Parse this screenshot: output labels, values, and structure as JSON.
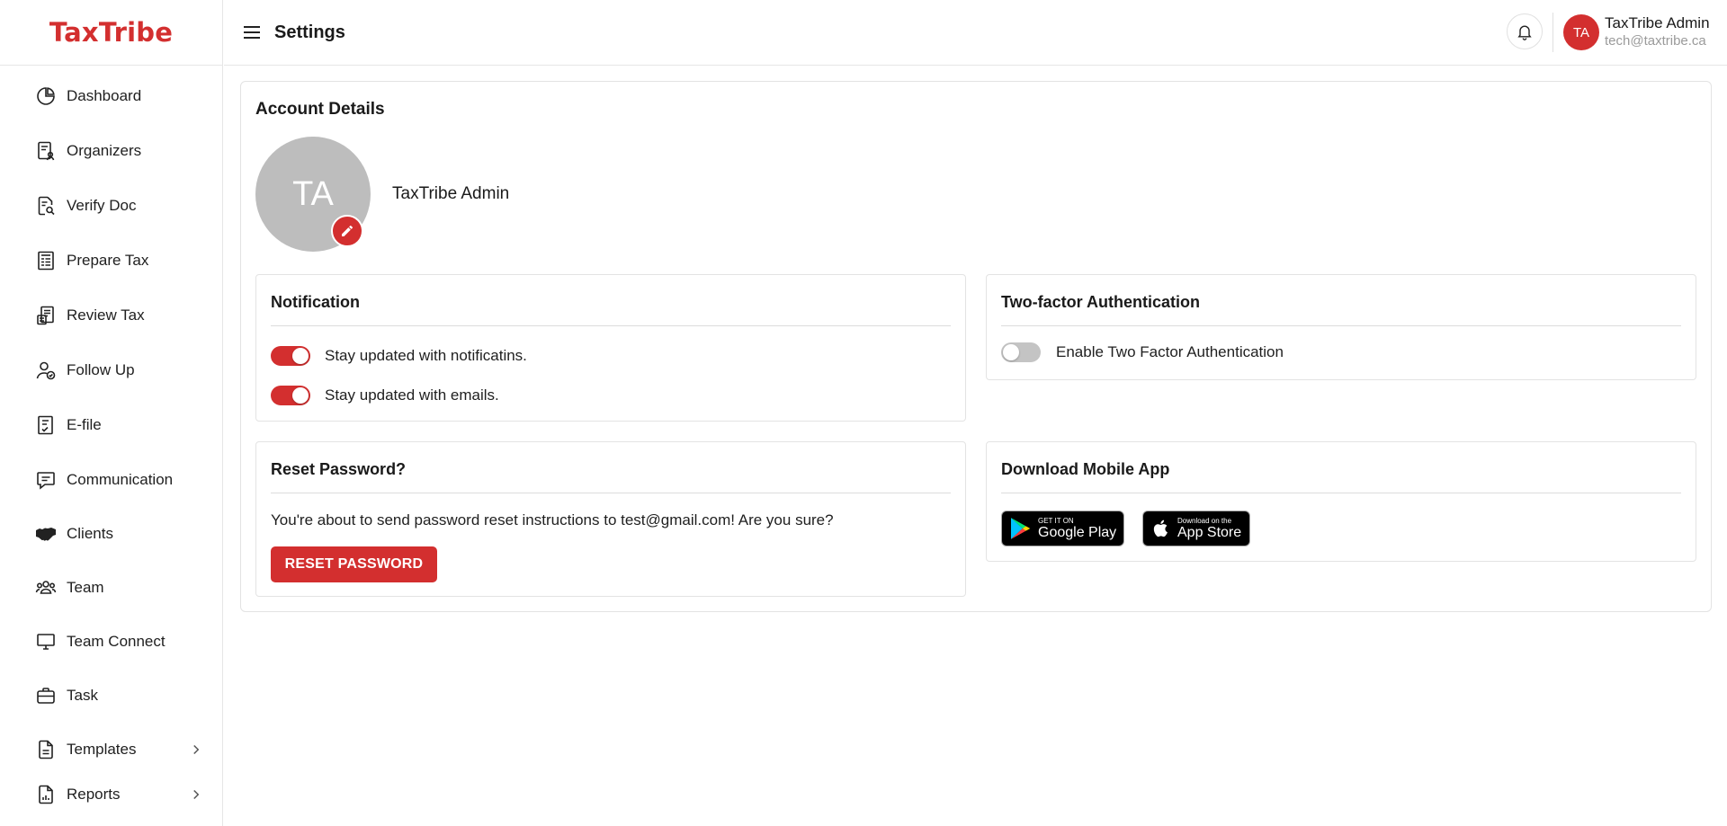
{
  "brand": {
    "name": "TaxTribe"
  },
  "header": {
    "title": "Settings",
    "avatar_initials": "TA",
    "user_name": "TaxTribe Admin",
    "user_email": "tech@taxtribe.ca"
  },
  "sidebar": {
    "items": [
      {
        "label": "Dashboard",
        "icon": "pie-chart-icon"
      },
      {
        "label": "Organizers",
        "icon": "document-person-icon"
      },
      {
        "label": "Verify Doc",
        "icon": "document-search-icon"
      },
      {
        "label": "Prepare Tax",
        "icon": "tax-form-icon"
      },
      {
        "label": "Review Tax",
        "icon": "tax-review-icon"
      },
      {
        "label": "Follow Up",
        "icon": "user-check-icon"
      },
      {
        "label": "E-file",
        "icon": "efile-icon"
      },
      {
        "label": "Communication",
        "icon": "message-icon"
      },
      {
        "label": "Clients",
        "icon": "handshake-icon"
      },
      {
        "label": "Team",
        "icon": "team-icon"
      },
      {
        "label": "Team Connect",
        "icon": "monitor-icon"
      },
      {
        "label": "Task",
        "icon": "briefcase-icon"
      },
      {
        "label": "Templates",
        "icon": "template-icon",
        "has_submenu": true
      },
      {
        "label": "Reports",
        "icon": "report-icon",
        "has_submenu": true
      }
    ]
  },
  "account": {
    "title": "Account Details",
    "avatar_initials": "TA",
    "name": "TaxTribe Admin"
  },
  "notification": {
    "title": "Notification",
    "toggles": [
      {
        "label": "Stay updated with notificatins.",
        "enabled": true
      },
      {
        "label": "Stay updated with emails.",
        "enabled": true
      }
    ]
  },
  "two_factor": {
    "title": "Two-factor Authentication",
    "toggle_label": "Enable Two Factor Authentication",
    "enabled": false
  },
  "reset_password": {
    "title": "Reset Password?",
    "message": "You're about to send password reset instructions to test@gmail.com! Are you sure?",
    "button_label": "RESET PASSWORD"
  },
  "mobile_app": {
    "title": "Download Mobile App",
    "google_play": {
      "small": "GET IT ON",
      "big": "Google Play"
    },
    "app_store": {
      "small": "Download on the",
      "big": "App Store"
    }
  },
  "colors": {
    "accent": "#d32f2f",
    "avatar_gray": "#bdbdbd",
    "toggle_off": "#c4c4c4"
  }
}
